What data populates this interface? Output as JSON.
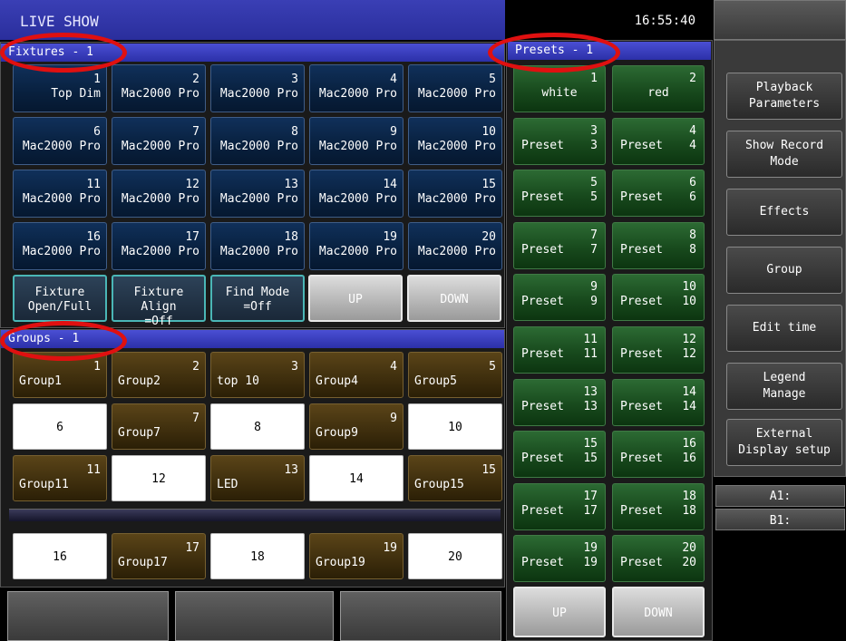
{
  "title": "LIVE SHOW",
  "clock": "16:55:40",
  "fixtures": {
    "header": "Fixtures - 1",
    "items": [
      {
        "num": "1",
        "name": "Top Dim"
      },
      {
        "num": "2",
        "name": "Mac2000 Pro"
      },
      {
        "num": "3",
        "name": "Mac2000 Pro"
      },
      {
        "num": "4",
        "name": "Mac2000 Pro"
      },
      {
        "num": "5",
        "name": "Mac2000 Pro"
      },
      {
        "num": "6",
        "name": "Mac2000 Pro"
      },
      {
        "num": "7",
        "name": "Mac2000 Pro"
      },
      {
        "num": "8",
        "name": "Mac2000 Pro"
      },
      {
        "num": "9",
        "name": "Mac2000 Pro"
      },
      {
        "num": "10",
        "name": "Mac2000 Pro"
      },
      {
        "num": "11",
        "name": "Mac2000 Pro"
      },
      {
        "num": "12",
        "name": "Mac2000 Pro"
      },
      {
        "num": "13",
        "name": "Mac2000 Pro"
      },
      {
        "num": "14",
        "name": "Mac2000 Pro"
      },
      {
        "num": "15",
        "name": "Mac2000 Pro"
      },
      {
        "num": "16",
        "name": "Mac2000 Pro"
      },
      {
        "num": "17",
        "name": "Mac2000 Pro"
      },
      {
        "num": "18",
        "name": "Mac2000 Pro"
      },
      {
        "num": "19",
        "name": "Mac2000 Pro"
      },
      {
        "num": "20",
        "name": "Mac2000 Pro"
      }
    ],
    "tools": [
      {
        "line1": "Fixture",
        "line2": "Open/Full"
      },
      {
        "line1": "Fixture Align",
        "line2": "=Off"
      },
      {
        "line1": "Find Mode",
        "line2": "=Off"
      }
    ],
    "up": "UP",
    "down": "DOWN"
  },
  "groups": {
    "header": "Groups - 1",
    "items": [
      {
        "num": "1",
        "name": "Group1",
        "type": "brown"
      },
      {
        "num": "2",
        "name": "Group2",
        "type": "brown"
      },
      {
        "num": "3",
        "name": "top 10",
        "type": "brown"
      },
      {
        "num": "4",
        "name": "Group4",
        "type": "brown"
      },
      {
        "num": "5",
        "name": "Group5",
        "type": "brown"
      },
      {
        "num": "",
        "name": "6",
        "type": "white"
      },
      {
        "num": "7",
        "name": "Group7",
        "type": "brown"
      },
      {
        "num": "",
        "name": "8",
        "type": "white"
      },
      {
        "num": "9",
        "name": "Group9",
        "type": "brown"
      },
      {
        "num": "",
        "name": "10",
        "type": "white"
      },
      {
        "num": "11",
        "name": "Group11",
        "type": "brown"
      },
      {
        "num": "",
        "name": "12",
        "type": "white"
      },
      {
        "num": "13",
        "name": "LED",
        "type": "brown"
      },
      {
        "num": "",
        "name": "14",
        "type": "white"
      },
      {
        "num": "15",
        "name": "Group15",
        "type": "brown"
      },
      {
        "num": "",
        "name": "16",
        "type": "white"
      },
      {
        "num": "17",
        "name": "Group17",
        "type": "brown"
      },
      {
        "num": "",
        "name": "18",
        "type": "white"
      },
      {
        "num": "19",
        "name": "Group19",
        "type": "brown"
      },
      {
        "num": "",
        "name": "20",
        "type": "white"
      }
    ]
  },
  "presets": {
    "header": "Presets - 1",
    "items": [
      {
        "num": "1",
        "label": "white",
        "n2": ""
      },
      {
        "num": "2",
        "label": "red",
        "n2": ""
      },
      {
        "num": "3",
        "label": "Preset",
        "n2": "3"
      },
      {
        "num": "4",
        "label": "Preset",
        "n2": "4"
      },
      {
        "num": "5",
        "label": "Preset",
        "n2": "5"
      },
      {
        "num": "6",
        "label": "Preset",
        "n2": "6"
      },
      {
        "num": "7",
        "label": "Preset",
        "n2": "7"
      },
      {
        "num": "8",
        "label": "Preset",
        "n2": "8"
      },
      {
        "num": "9",
        "label": "Preset",
        "n2": "9"
      },
      {
        "num": "10",
        "label": "Preset",
        "n2": "10"
      },
      {
        "num": "11",
        "label": "Preset",
        "n2": "11"
      },
      {
        "num": "12",
        "label": "Preset",
        "n2": "12"
      },
      {
        "num": "13",
        "label": "Preset",
        "n2": "13"
      },
      {
        "num": "14",
        "label": "Preset",
        "n2": "14"
      },
      {
        "num": "15",
        "label": "Preset",
        "n2": "15"
      },
      {
        "num": "16",
        "label": "Preset",
        "n2": "16"
      },
      {
        "num": "17",
        "label": "Preset",
        "n2": "17"
      },
      {
        "num": "18",
        "label": "Preset",
        "n2": "18"
      },
      {
        "num": "19",
        "label": "Preset",
        "n2": "19"
      },
      {
        "num": "20",
        "label": "Preset",
        "n2": "20"
      }
    ],
    "up": "UP",
    "down": "DOWN"
  },
  "sidebar": [
    {
      "line1": "Playback",
      "line2": "Parameters"
    },
    {
      "line1": "Show Record",
      "line2": "Mode"
    },
    {
      "line1": "Effects",
      "line2": ""
    },
    {
      "line1": "Group",
      "line2": ""
    },
    {
      "line1": "Edit time",
      "line2": ""
    },
    {
      "line1": "Legend",
      "line2": "Manage"
    },
    {
      "line1": "External",
      "line2": "Display setup"
    }
  ],
  "ab": {
    "a": "A1:",
    "b": "B1:"
  },
  "colors": {
    "header": "#3a3fb5",
    "fixture": "#0c2a50",
    "group": "#4a3610",
    "preset": "#1e5a24",
    "highlight": "#e01010"
  }
}
